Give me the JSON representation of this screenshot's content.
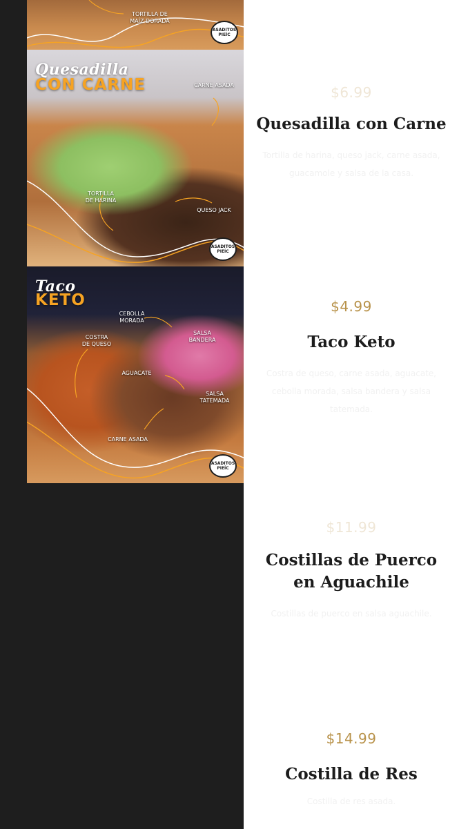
{
  "photos": [
    {
      "labels": {
        "tortilla": "TORTILLA DE\nMAÍZ DORADA"
      },
      "logo": "ASADITOS\nPIEÍC"
    },
    {
      "script_title": "Quesadilla",
      "big_title": "CON CARNE",
      "labels": {
        "carne": "CARNE ASADA",
        "tortilla": "TORTILLA\nDE HARINA",
        "queso": "QUESO JACK"
      },
      "logo": "ASADITOS\nPIEÍC"
    },
    {
      "script_title": "Taco",
      "big_title": "KETO",
      "labels": {
        "cebolla": "CEBOLLA\nMORADA",
        "costra": "COSTRA\nDE QUESO",
        "bandera": "SALSA\nBANDERA",
        "aguacate": "AGUACATE",
        "tatemada": "SALSA\nTATEMADA",
        "carne": "CARNE ASADA"
      },
      "logo": "ASADITOS\nPIEÍC"
    }
  ],
  "items": [
    {
      "price": "$6.99",
      "title": "Quesadilla con Carne",
      "description": "Tortilla de harina, queso jack, carne asada, guacamole y salsa de la casa."
    },
    {
      "price": "$4.99",
      "title": "Taco Keto",
      "description": "Costra de queso, carne asada, aguacate, cebolla morada, salsa bandera y salsa tatemada."
    },
    {
      "price": "$11.99",
      "title": "Costillas de Puerco en Aguachile",
      "description": "Costillas de puerco en salsa aguachile."
    },
    {
      "price": "$14.99",
      "title": "Costilla de Res",
      "description": "Costilla de res asada."
    }
  ],
  "colors": {
    "dark_background": "#1e1e1e",
    "price_gold": "#b8924a",
    "title_text": "#1c1c1c",
    "photo_accent_orange": "#f6a323"
  }
}
